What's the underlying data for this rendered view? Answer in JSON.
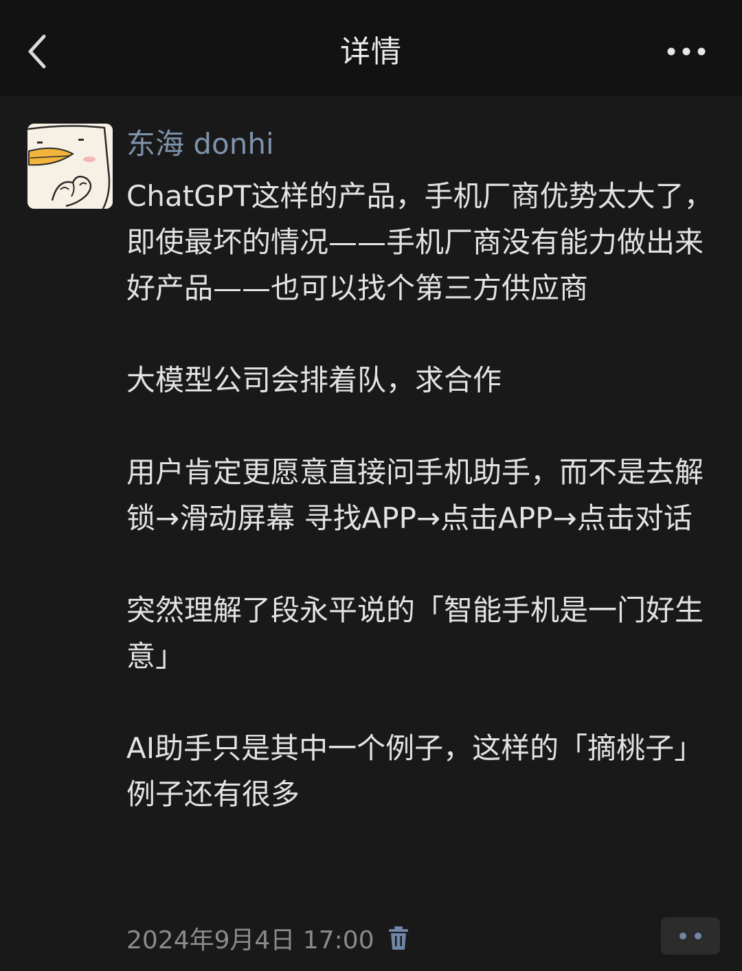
{
  "header": {
    "title": "详情",
    "back_icon": "chevron-left-icon",
    "more_icon": "more-horizontal-icon"
  },
  "post": {
    "author": "东海 donhi",
    "avatar_icon": "duck-avatar",
    "paragraphs": [
      "ChatGPT这样的产品，手机厂商优势太大了，即使最坏的情况——手机厂商没有能力做出来好产品——也可以找个第三方供应商",
      "大模型公司会排着队，求合作",
      "用户肯定更愿意直接问手机助手，而不是去解锁→滑动屏幕 寻找APP→点击APP→点击对话",
      "突然理解了段永平说的「智能手机是一门好生意」",
      "AI助手只是其中一个例子，这样的「摘桃子」例子还有很多"
    ],
    "timestamp": "2024年9月4日 17:00",
    "delete_icon": "trash-icon",
    "action_icon": "two-dots-icon"
  },
  "colors": {
    "background": "#191919",
    "header_background": "#121212",
    "author_name": "#7f93ad",
    "body_text": "#e3e3e3",
    "timestamp": "#8b8b8b",
    "icon_accent": "#6f86a6"
  }
}
